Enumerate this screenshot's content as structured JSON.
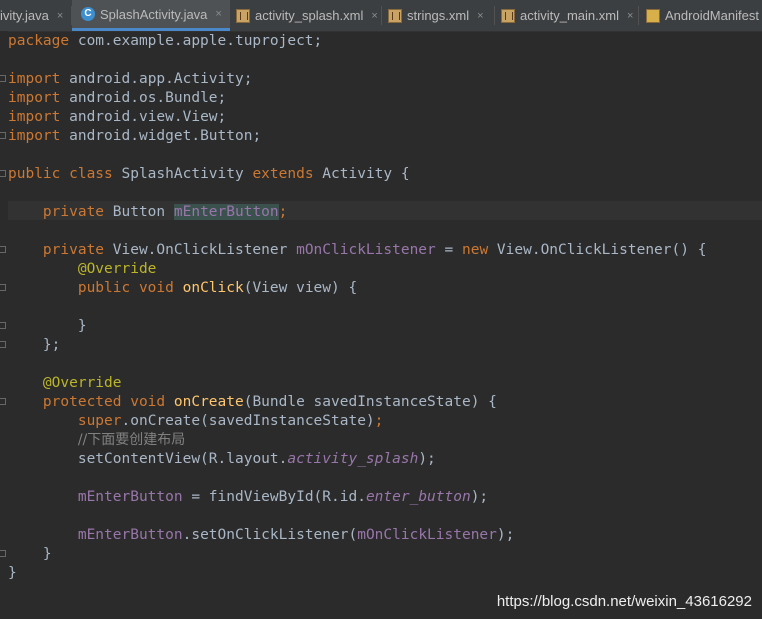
{
  "tabs": [
    {
      "label": "ivity.java",
      "icon": "java-file-icon",
      "active": false
    },
    {
      "label": "SplashActivity.java",
      "icon": "class-c-icon",
      "active": true
    },
    {
      "label": "activity_splash.xml",
      "icon": "xml-file-icon",
      "active": false
    },
    {
      "label": "strings.xml",
      "icon": "xml-file-icon",
      "active": false
    },
    {
      "label": "activity_main.xml",
      "icon": "xml-file-icon",
      "active": false
    },
    {
      "label": "AndroidManifest",
      "icon": "manifest-file-icon",
      "active": false
    }
  ],
  "close_glyph": "×",
  "code": {
    "l1_kw": "package",
    "l1_rest": " com.example.apple.tuproject;",
    "imp_kw": "import",
    "imp1": " android.app.Activity;",
    "imp2": " android.os.Bundle;",
    "imp3": " android.view.View;",
    "imp4": " android.widget.Button;",
    "cls_kw1": "public class",
    "cls_name": " SplashActivity ",
    "cls_kw2": "extends",
    "cls_rest": " Activity {",
    "fld_kw": "private",
    "fld_type": " Button ",
    "fld_name": "mEnterButton",
    "semi": ";",
    "lis_type": " View.OnClickListener ",
    "lis_name": "mOnClickListener",
    "lis_eq": " = ",
    "new_kw": "new",
    "lis_rest": " View.OnClickListener() {",
    "override": "@Override",
    "oc_kw": "public void",
    "oc_name": "onClick",
    "oc_rest": "(View view) {",
    "close_brace": "}",
    "close_brace_semi": "};",
    "ocr_kw": "protected void",
    "ocr_name": "onCreate",
    "ocr_rest": "(Bundle savedInstanceState) {",
    "super_kw": "super",
    "super_rest": ".onCreate(savedInstanceState)",
    "comment": "//下面要创建布局",
    "scv_start": "setContentView(R.layout.",
    "scv_field": "activity_splash",
    "scv_end": ");",
    "fvb_lhs": "mEnterButton",
    "fvb_mid": " = findViewById(R.id.",
    "fvb_field": "enter_button",
    "fvb_end": ");",
    "set_lhs": "mEnterButton",
    "set_mid": ".setOnClickListener(",
    "set_arg": "mOnClickListener",
    "set_end": ");"
  },
  "watermark": "https://blog.csdn.net/weixin_43616292",
  "colors": {
    "background": "#2b2b2b",
    "keyword": "#cc7832",
    "annotation": "#bbb529",
    "method": "#ffc66d",
    "field": "#9876aa",
    "text": "#a9b7c6",
    "comment": "#808080"
  }
}
